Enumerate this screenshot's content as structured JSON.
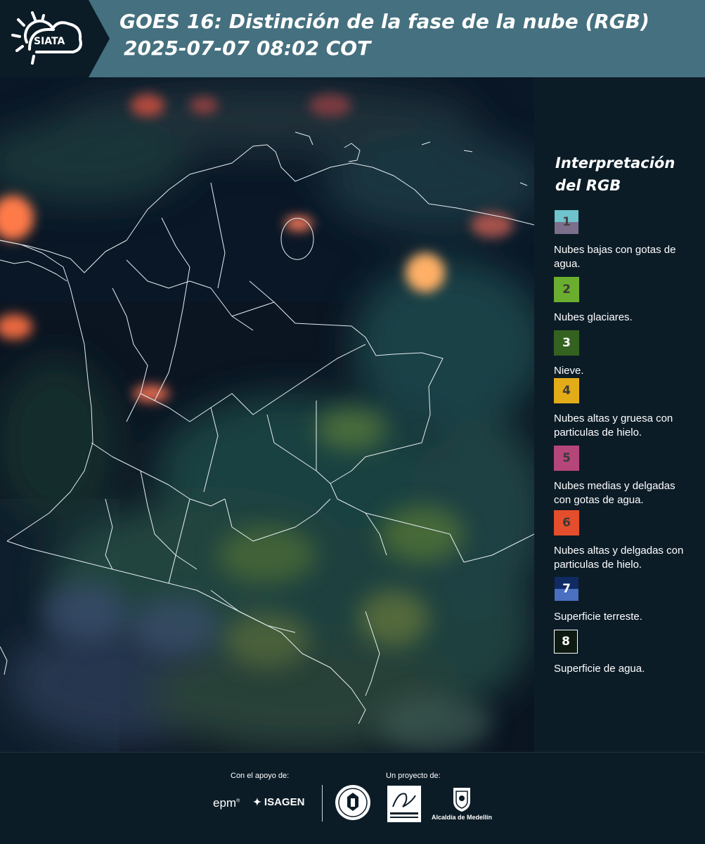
{
  "header": {
    "logo_text": "SIATA",
    "title_line1": "GOES 16: Distinción de la fase de la nube (RGB)",
    "title_line2": "2025-07-07 08:02 COT",
    "bg_color": "#45707f"
  },
  "legend": {
    "title_line1": "Interpretación",
    "title_line2": "del RGB",
    "items": [
      {
        "number": "1",
        "label": "Nubes bajas con gotas de agua.",
        "colors": [
          "#6ec3cc",
          "#7b6f8c"
        ],
        "number_color": "#444444"
      },
      {
        "number": "2",
        "label": "Nubes glaciares.",
        "colors": [
          "#6bae2f"
        ],
        "number_color": "#3a3a3a"
      },
      {
        "number": "3",
        "label": "Nieve.",
        "colors": [
          "#346220"
        ],
        "number_color": "#ffffff"
      },
      {
        "number": "4",
        "label": "Nubes altas y gruesa con particulas de hielo.",
        "colors": [
          "#e2ab18"
        ],
        "number_color": "#3a3a3a"
      },
      {
        "number": "5",
        "label": "Nubes medias y delgadas con gotas de agua.",
        "colors": [
          "#b5467a"
        ],
        "number_color": "#3a3a3a"
      },
      {
        "number": "6",
        "label": "Nubes altas y delgadas con particulas de hielo.",
        "colors": [
          "#e44e2c"
        ],
        "number_color": "#3a3a3a"
      },
      {
        "number": "7",
        "label": "Superficie terreste.",
        "colors": [
          "#102a63",
          "#4a6fc0"
        ],
        "number_color": "#ffffff"
      },
      {
        "number": "8",
        "label": "Superficie de agua.",
        "colors": [
          "#0c1a12"
        ],
        "number_color": "#ffffff"
      }
    ]
  },
  "footer": {
    "support_label": "Con el apoyo de:",
    "project_label": "Un proyecto de:",
    "sponsor_epm": "epm",
    "sponsor_isagen": "ISAGEN",
    "alcaldia": "Alcaldía de Medellín"
  }
}
